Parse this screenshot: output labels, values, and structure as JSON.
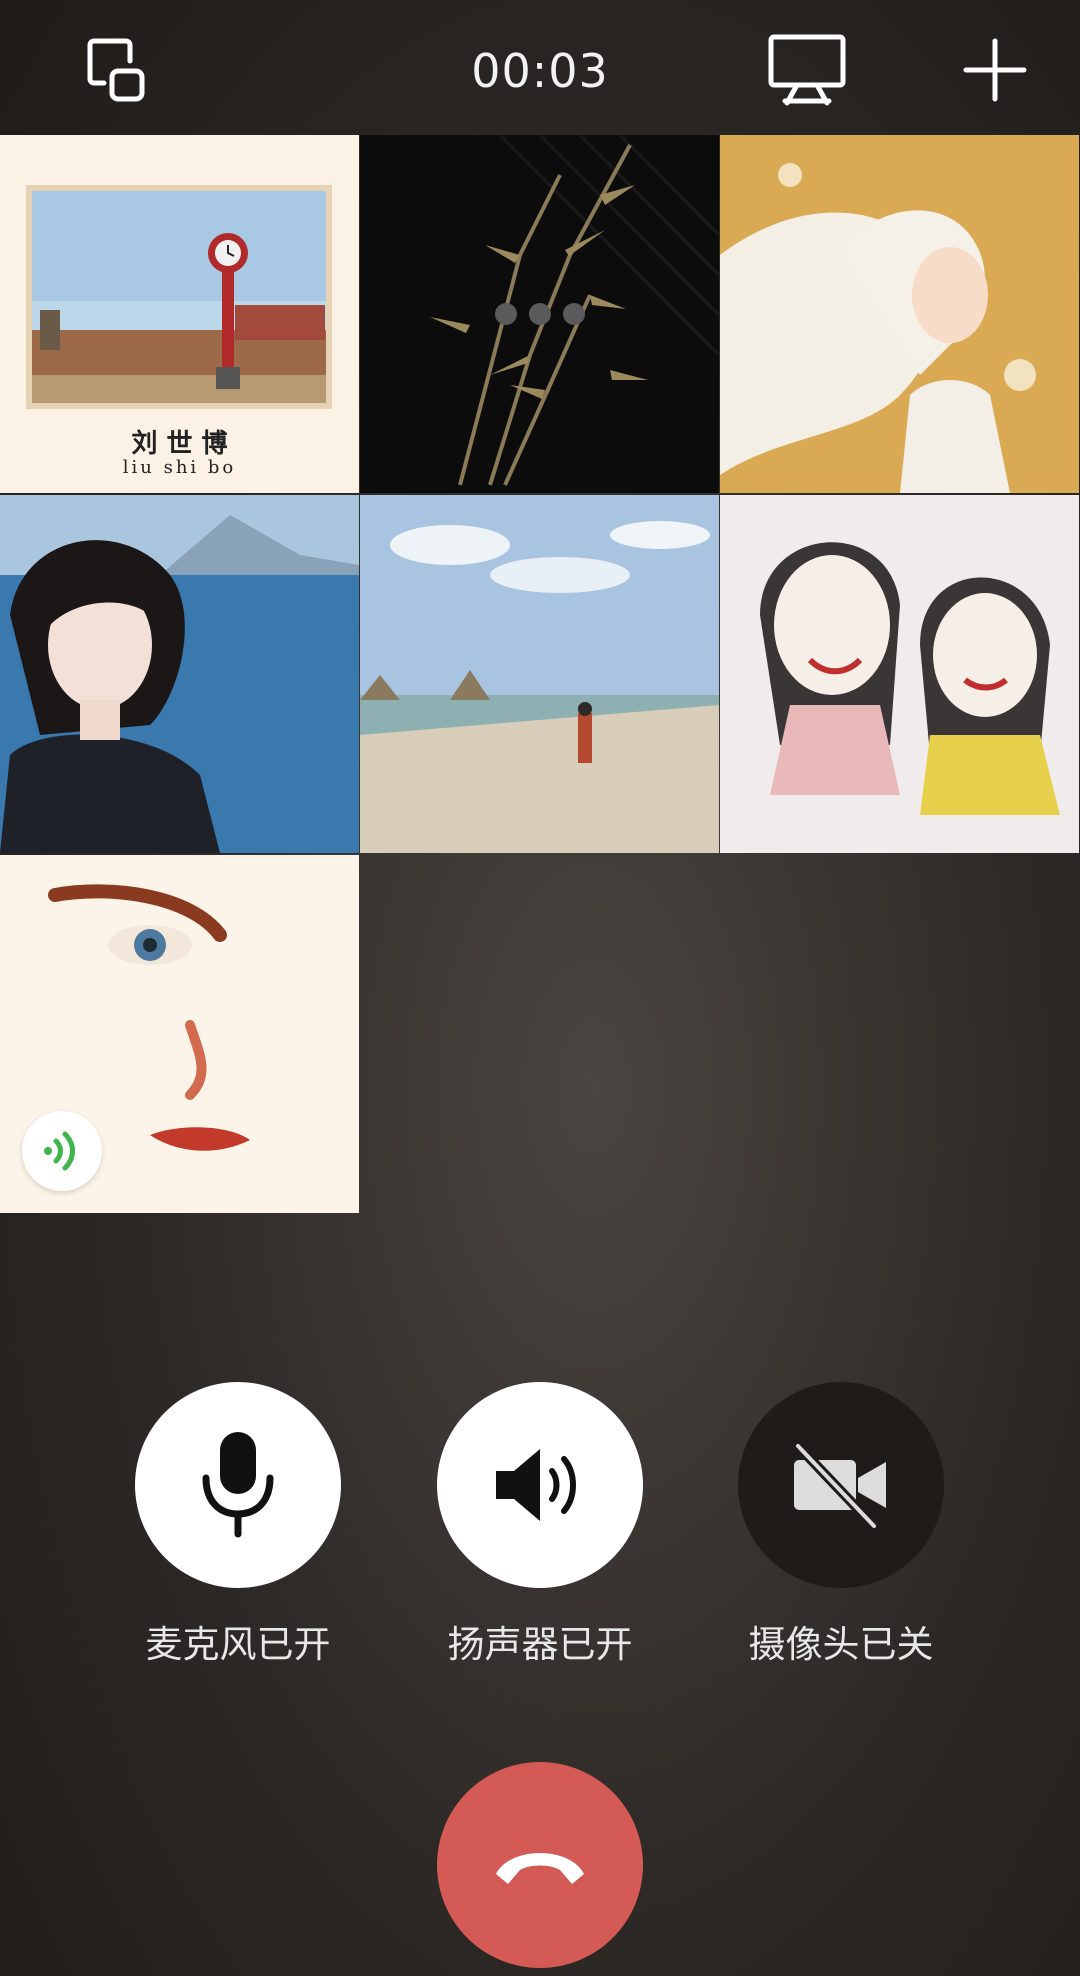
{
  "call": {
    "timer": "00:03"
  },
  "topbar": {
    "left_icon": "minimize-window-icon",
    "share_icon": "screen-share-icon",
    "add_icon": "add-member-icon"
  },
  "participants": [
    {
      "name_han": "刘 世 博",
      "name_pinyin": "liu shi bo",
      "avatar": "clock-tower-photo"
    },
    {
      "avatar": "bamboo-ink-painting",
      "status": "connecting"
    },
    {
      "avatar": "white-hair-girl-illustration"
    },
    {
      "avatar": "girl-by-sea-photo"
    },
    {
      "avatar": "beach-painting"
    },
    {
      "avatar": "two-girls-caricature"
    },
    {
      "avatar": "watercolor-face",
      "speaking": true
    }
  ],
  "controls": {
    "mic_label": "麦克风已开",
    "speaker_label": "扬声器已开",
    "camera_label": "摄像头已关"
  },
  "colors": {
    "hangup": "#d45a55",
    "speaking": "#3fb54c"
  }
}
